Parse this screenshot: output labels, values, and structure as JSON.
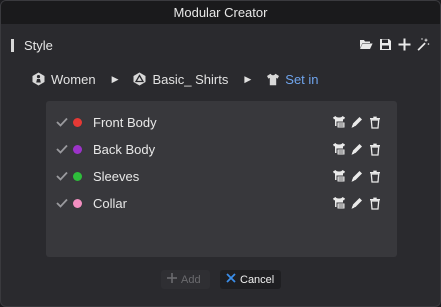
{
  "window": {
    "title": "Modular Creator"
  },
  "section": {
    "title": "Style"
  },
  "header_icons": [
    "folder-open-icon",
    "save-icon",
    "plus-icon",
    "magic-wand-icon"
  ],
  "breadcrumb": [
    {
      "label": "Women",
      "icon": "figure-icon"
    },
    {
      "label": "Basic_ Shirts",
      "icon": "shirt-triangle-icon"
    },
    {
      "label": "Set in",
      "icon": "shirt-icon",
      "active": true
    }
  ],
  "items": [
    {
      "label": "Front Body",
      "color": "#e53935",
      "checked": true
    },
    {
      "label": "Back Body",
      "color": "#9c33c9",
      "checked": true
    },
    {
      "label": "Sleeves",
      "color": "#2ebd3b",
      "checked": true
    },
    {
      "label": "Collar",
      "color": "#f28ec0",
      "checked": true
    }
  ],
  "buttons": {
    "add_label": "Add",
    "cancel_label": "Cancel"
  },
  "colors": {
    "accent": "#6fa4ec",
    "cancel_icon": "#3b8eea"
  }
}
